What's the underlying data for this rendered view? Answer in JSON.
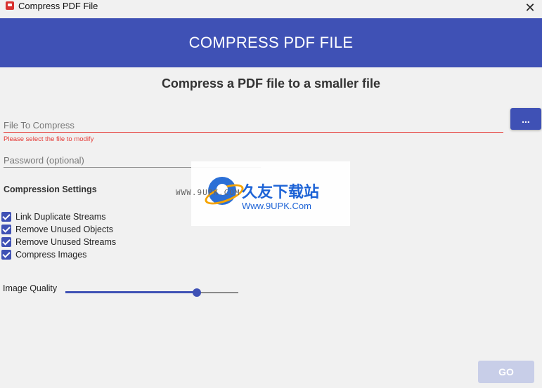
{
  "window": {
    "title": "Compress PDF File",
    "close_glyph": "✕",
    "icon": "pdf-app-icon"
  },
  "header": {
    "title": "COMPRESS PDF FILE",
    "background": "#3f51b5"
  },
  "subtitle": "Compress a PDF file to a smaller file",
  "file_field": {
    "label": "File To Compress",
    "value": "",
    "error": "Please select the file to modify",
    "error_color": "#e53935",
    "browse_label": "..."
  },
  "password_field": {
    "label": "Password (optional)",
    "value": ""
  },
  "settings": {
    "title": "Compression Settings",
    "options": [
      {
        "label": "Link Duplicate Streams",
        "checked": true
      },
      {
        "label": "Remove Unused Objects",
        "checked": true
      },
      {
        "label": "Remove Unused Streams",
        "checked": true
      },
      {
        "label": "Compress Images",
        "checked": true
      }
    ]
  },
  "image_quality": {
    "label": "Image Quality",
    "value_fraction": 0.76
  },
  "go_button": {
    "label": "GO",
    "enabled": false
  },
  "watermark": {
    "cn_text": "久友下载站",
    "url": "Www.9UPK.Com",
    "small_text": "WWW.9UPK.COM"
  },
  "colors": {
    "accent": "#3f51b5",
    "error": "#e53935",
    "disabled_button": "#c8cee8"
  }
}
